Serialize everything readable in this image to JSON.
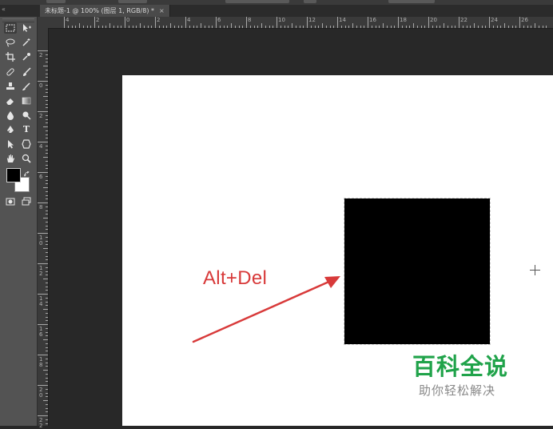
{
  "document_tab": {
    "title": "未标题-1 @ 100% (图层 1, RGB/8) *",
    "close_glyph": "×"
  },
  "tab_collapse_glyph": "«",
  "toolbar": {
    "tools": [
      {
        "name": "marquee-tool-icon",
        "active": true
      },
      {
        "name": "move-tool-icon"
      },
      {
        "name": "lasso-tool-icon"
      },
      {
        "name": "magic-wand-tool-icon"
      },
      {
        "name": "crop-tool-icon"
      },
      {
        "name": "eyedropper-tool-icon"
      },
      {
        "name": "healing-brush-tool-icon"
      },
      {
        "name": "brush-tool-icon"
      },
      {
        "name": "clone-stamp-tool-icon"
      },
      {
        "name": "history-brush-tool-icon"
      },
      {
        "name": "eraser-tool-icon"
      },
      {
        "name": "gradient-tool-icon"
      },
      {
        "name": "blur-tool-icon"
      },
      {
        "name": "dodge-tool-icon"
      },
      {
        "name": "pen-tool-icon"
      },
      {
        "name": "type-tool-icon",
        "glyph": "T"
      },
      {
        "name": "path-selection-tool-icon"
      },
      {
        "name": "shape-tool-icon"
      },
      {
        "name": "hand-tool-icon"
      },
      {
        "name": "zoom-tool-icon"
      }
    ],
    "foreground_color": "#000000",
    "background_color": "#ffffff"
  },
  "ruler_top_labels": [
    "4",
    "2",
    "0",
    "2",
    "4",
    "6",
    "8",
    "10",
    "12",
    "14",
    "16",
    "18",
    "20",
    "22",
    "24",
    "26"
  ],
  "ruler_left_labels": [
    "2",
    "0",
    "2",
    "4",
    "6",
    "8",
    "1 0",
    "1 2",
    "1 4",
    "1 6",
    "1 8",
    "2 0",
    "2 2",
    "2 4"
  ],
  "canvas": {
    "annotation": "Alt+Del",
    "annotation_color": "#d83a3a",
    "fill_color": "#000000"
  },
  "watermark": {
    "title": "百科全说",
    "subtitle": "助你轻松解决",
    "title_color": "#20a34a"
  }
}
